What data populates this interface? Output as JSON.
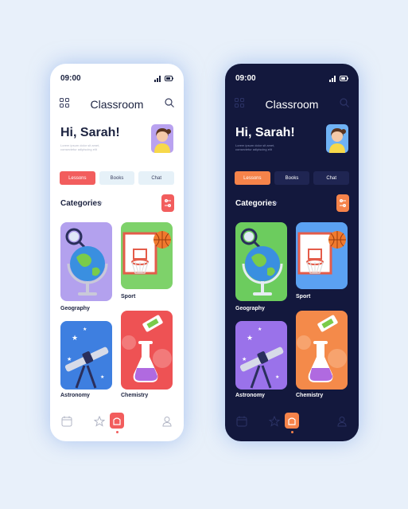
{
  "colors": {
    "page_bg": "#e8f0fa",
    "light_accent": "#f25d5d",
    "dark_bg": "#13183d",
    "dark_accent": "#f6834a"
  },
  "light": {
    "status_time": "09:00",
    "app_title": "Classroom",
    "greeting": "Hi, Sarah!",
    "greeting_sub": "Lorem ipsum dolor sit amet, consectetur adipiscing elit",
    "tabs": [
      "Lessons",
      "Books",
      "Chat"
    ],
    "categories_title": "Categories",
    "cards": [
      {
        "label": "Geography",
        "icon": "globe-icon"
      },
      {
        "label": "Sport",
        "icon": "basketball-icon"
      },
      {
        "label": "Astronomy",
        "icon": "telescope-icon"
      },
      {
        "label": "Chemistry",
        "icon": "flask-icon"
      }
    ],
    "nav": [
      "calendar-icon",
      "star-icon",
      "home-icon",
      "user-icon"
    ]
  },
  "dark": {
    "status_time": "09:00",
    "app_title": "Classroom",
    "greeting": "Hi, Sarah!",
    "greeting_sub": "Lorem ipsum dolor sit amet, consectetur adipiscing elit",
    "tabs": [
      "Lessons",
      "Books",
      "Chat"
    ],
    "categories_title": "Categories",
    "cards": [
      {
        "label": "Geography",
        "icon": "globe-icon"
      },
      {
        "label": "Sport",
        "icon": "basketball-icon"
      },
      {
        "label": "Astronomy",
        "icon": "telescope-icon"
      },
      {
        "label": "Chemistry",
        "icon": "flask-icon"
      }
    ],
    "nav": [
      "calendar-icon",
      "star-icon",
      "home-icon",
      "user-icon"
    ]
  }
}
